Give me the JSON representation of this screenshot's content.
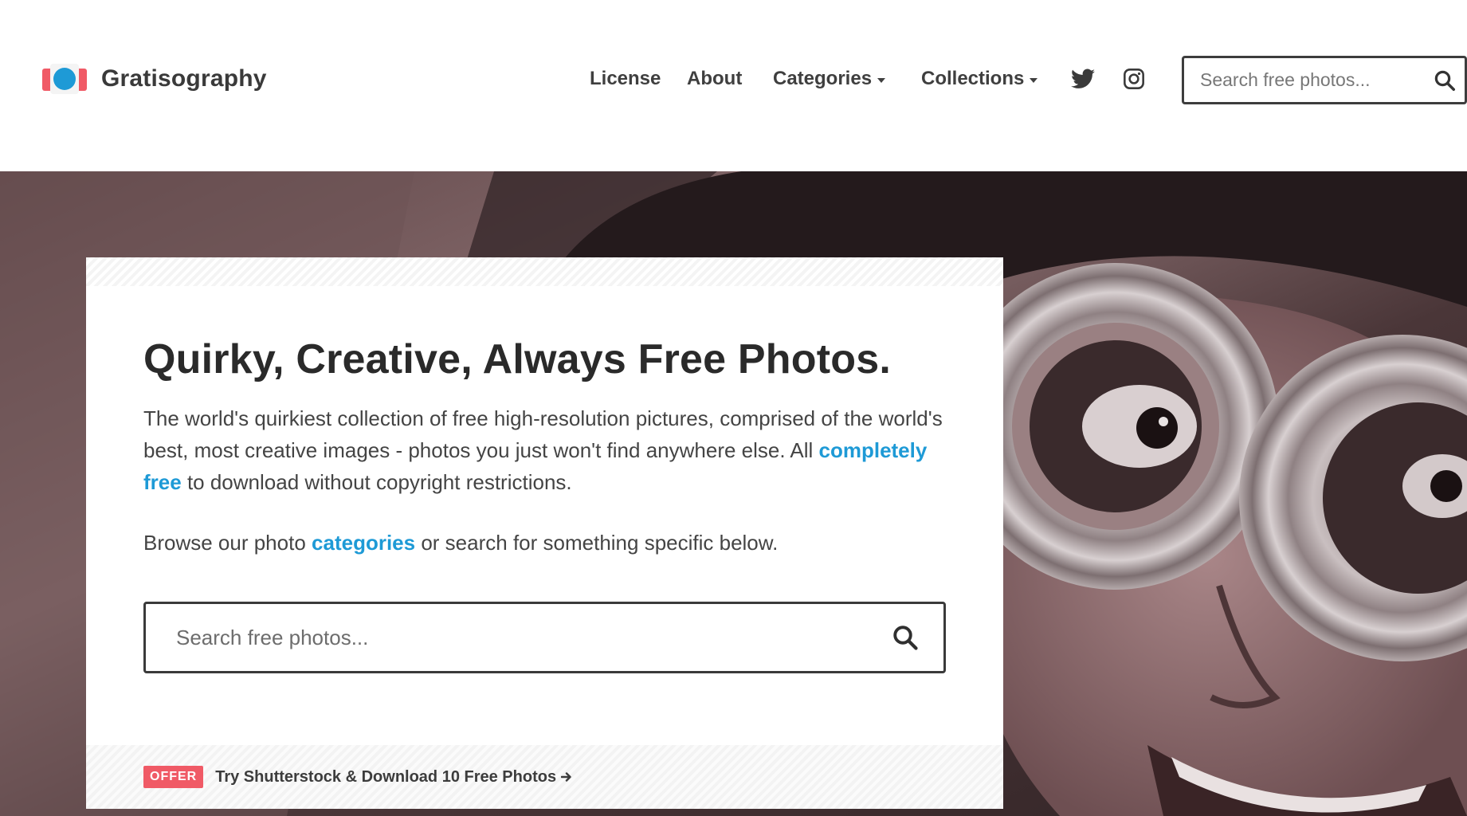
{
  "brand": {
    "name": "Gratisography",
    "colors": {
      "coral": "#f05a66",
      "blue": "#1e9ad6"
    }
  },
  "nav": {
    "items": [
      {
        "label": "License"
      },
      {
        "label": "About"
      },
      {
        "label": "Categories",
        "has_dropdown": true
      },
      {
        "label": "Collections",
        "has_dropdown": true
      }
    ],
    "social": [
      "twitter-icon",
      "instagram-icon"
    ]
  },
  "header_search": {
    "placeholder": "Search free photos..."
  },
  "hero": {
    "title": "Quirky, Creative, Always Free Photos.",
    "desc_text": "The world's quirkiest collection of free high-resolution pictures, comprised of the world's best, most creative images - photos you just won't find anywhere else. All",
    "desc_link": "completely free",
    "desc_tail": "to download without copyright restrictions.",
    "browse_prefix": "Browse our photo",
    "browse_link": "categories",
    "browse_suffix": "or search for something specific below.",
    "search_placeholder": "Search free photos...",
    "offer_badge": "OFFER",
    "offer_text": "Try Shutterstock & Download 10 Free Photos"
  }
}
